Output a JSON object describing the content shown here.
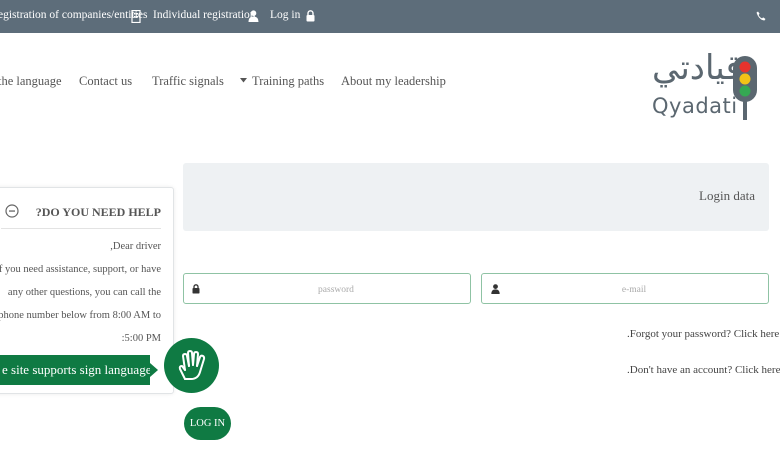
{
  "topbar": {
    "register_companies": "egistration of companies/entities",
    "individual_registration": "Individual registration",
    "login": "Log in"
  },
  "nav": {
    "language": "the language",
    "contact": "Contact us",
    "traffic_signals": "Traffic signals",
    "training_paths": "Training paths",
    "about": "About my leadership"
  },
  "logo": {
    "arabic": "قيادتي",
    "latin": "Qyadati"
  },
  "login_panel": {
    "title": "Login data",
    "password_placeholder": "password",
    "email_placeholder": "e-mail",
    "forgot": ".Forgot your password? Click here",
    "no_account": ".Don't have an account? Click here",
    "button": "LOG IN"
  },
  "help": {
    "title": "?DO YOU NEED HELP",
    "lines": [
      ",Dear driver",
      "if you need assistance, support, or have",
      "any other questions, you can call the",
      "phone number below from 8:00 AM to",
      ":5:00 PM"
    ],
    "sign_language": "e site supports sign language"
  },
  "colors": {
    "topbar": "#5d6d7a",
    "brand_green": "#0f7a43",
    "panel_bg": "#eef1f3"
  }
}
